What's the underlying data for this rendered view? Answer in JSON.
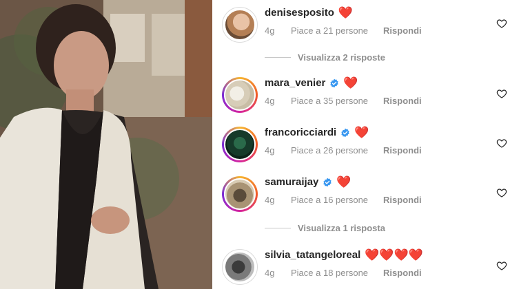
{
  "post_image": {
    "alt_icon": "portrait-photo"
  },
  "comments": [
    {
      "username": "denisesposito",
      "verified": false,
      "reaction": "❤️",
      "time": "4g",
      "likes": "Piace a 21 persone",
      "reply": "Rispondi"
    },
    {
      "username": "mara_venier",
      "verified": true,
      "reaction": "❤️",
      "time": "4g",
      "likes": "Piace a 35 persone",
      "reply": "Rispondi"
    },
    {
      "username": "francoricciardi",
      "verified": true,
      "reaction": "❤️",
      "time": "4g",
      "likes": "Piace a 26 persone",
      "reply": "Rispondi"
    },
    {
      "username": "samuraijay",
      "verified": true,
      "reaction": "❤️",
      "time": "4g",
      "likes": "Piace a 16 persone",
      "reply": "Rispondi"
    },
    {
      "username": "silvia_tatangeloreal",
      "verified": false,
      "reaction": "❤️❤️❤️❤️",
      "time": "4g",
      "likes": "Piace a 18 persone",
      "reply": "Rispondi"
    }
  ],
  "reply_toggles": {
    "first": "Visualizza 2 risposte",
    "second": "Visualizza 1 risposta"
  },
  "colors": {
    "verified": "#3897f0",
    "heart": "#ed4956",
    "muted": "#8e8e8e"
  }
}
